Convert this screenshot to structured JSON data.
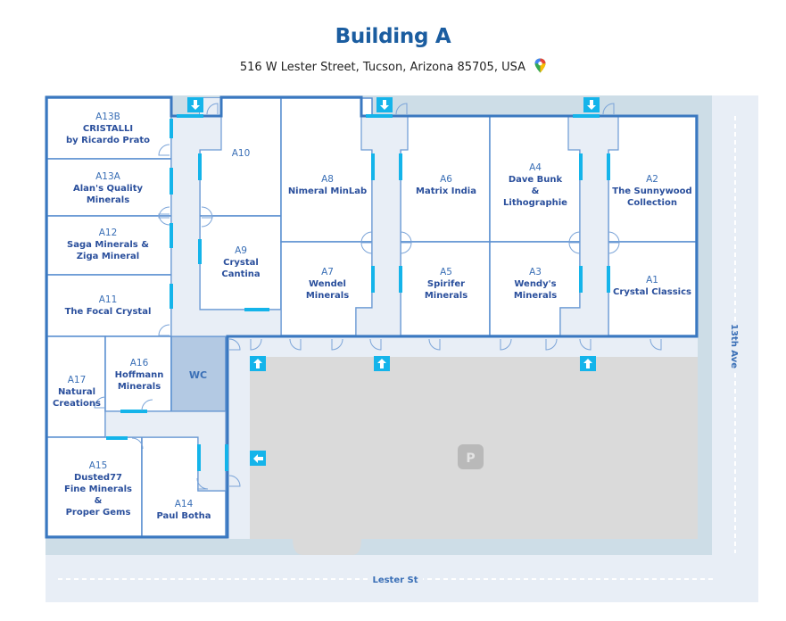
{
  "header": {
    "title": "Building A",
    "address": "516 W Lester Street, Tucson, Arizona 85705, USA",
    "map_pin_icon": "google-maps-pin-icon"
  },
  "colors": {
    "title": "#1b5da0",
    "wall": "#3a78c0",
    "corridor": "#e8eef6",
    "outdoor": "#cddde7",
    "parking": "#dadada",
    "door_accent": "#14b4ea",
    "wc": "#b3c9e3",
    "text_name": "#2a4f9c",
    "text_id": "#3a6fb6"
  },
  "rooms": [
    {
      "id": "A13B",
      "name": [
        "CRISTALLI",
        "by Ricardo Prato"
      ]
    },
    {
      "id": "A13A",
      "name": [
        "Alan's Quality",
        "Minerals"
      ]
    },
    {
      "id": "A12",
      "name": [
        "Saga Minerals &",
        "Ziga Mineral"
      ]
    },
    {
      "id": "A11",
      "name": [
        "The Focal Crystal"
      ]
    },
    {
      "id": "A10",
      "name": []
    },
    {
      "id": "A9",
      "name": [
        "Crystal",
        "Cantina"
      ]
    },
    {
      "id": "A8",
      "name": [
        "Nimeral MinLab"
      ]
    },
    {
      "id": "A7",
      "name": [
        "Wendel",
        "Minerals"
      ]
    },
    {
      "id": "A6",
      "name": [
        "Matrix India"
      ]
    },
    {
      "id": "A5",
      "name": [
        "Spirifer",
        "Minerals"
      ]
    },
    {
      "id": "A4",
      "name": [
        "Dave Bunk",
        "&",
        "Lithographie"
      ]
    },
    {
      "id": "A3",
      "name": [
        "Wendy's",
        "Minerals"
      ]
    },
    {
      "id": "A2",
      "name": [
        "The Sunnywood",
        "Collection"
      ]
    },
    {
      "id": "A1",
      "name": [
        "Crystal Classics"
      ]
    },
    {
      "id": "A17",
      "name": [
        "Natural",
        "Creations"
      ]
    },
    {
      "id": "A16",
      "name": [
        "Hoffmann",
        "Minerals"
      ]
    },
    {
      "id": "A15",
      "name": [
        "Dusted77",
        "Fine Minerals",
        "&",
        "Proper Gems"
      ]
    },
    {
      "id": "A14",
      "name": [
        "Paul Botha"
      ]
    }
  ],
  "facilities": {
    "wc_label": "WC",
    "parking_label": "P"
  },
  "entrances": [
    {
      "direction": "down",
      "icon": "arrow-down-icon"
    },
    {
      "direction": "down",
      "icon": "arrow-down-icon"
    },
    {
      "direction": "down",
      "icon": "arrow-down-icon"
    },
    {
      "direction": "up",
      "icon": "arrow-up-icon"
    },
    {
      "direction": "up",
      "icon": "arrow-up-icon"
    },
    {
      "direction": "up",
      "icon": "arrow-up-icon"
    },
    {
      "direction": "left",
      "icon": "arrow-left-icon"
    }
  ],
  "streets": {
    "bottom": "Lester St",
    "right": "13th Ave"
  }
}
